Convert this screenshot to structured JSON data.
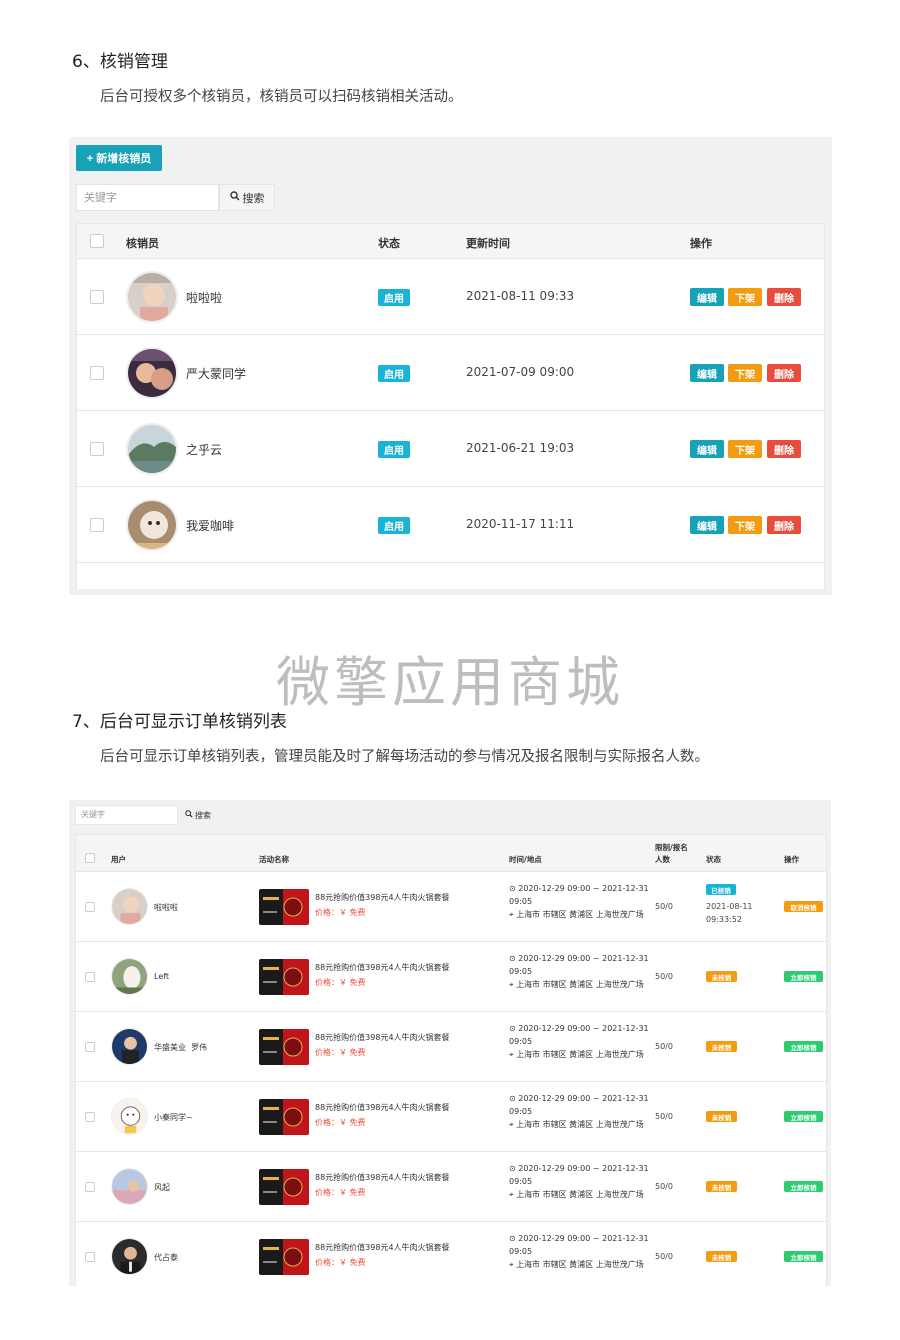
{
  "section1": {
    "title": "6、核销管理",
    "desc": "后台可授权多个核销员，核销员可以扫码核销相关活动。",
    "add_button": "+ 新增核销员",
    "search_placeholder": "关键字",
    "search_button": "搜索",
    "headers": {
      "user": "核销员",
      "status": "状态",
      "updated": "更新时间",
      "ops": "操作"
    },
    "rows": [
      {
        "name": "啦啦啦",
        "status": "启用",
        "time": "2021-08-11 09:33",
        "edit": "编辑",
        "off": "下架",
        "del": "删除"
      },
      {
        "name": "严大蒙同学",
        "status": "启用",
        "time": "2021-07-09 09:00",
        "edit": "编辑",
        "off": "下架",
        "del": "删除"
      },
      {
        "name": "之乎云",
        "status": "启用",
        "time": "2021-06-21 19:03",
        "edit": "编辑",
        "off": "下架",
        "del": "删除"
      },
      {
        "name": "我爱咖啡",
        "status": "启用",
        "time": "2020-11-17 11:11",
        "edit": "编辑",
        "off": "下架",
        "del": "删除"
      }
    ]
  },
  "watermark": "微擎应用商城",
  "section2": {
    "title": "7、后台可显示订单核销列表",
    "desc": "后台可显示订单核销列表，管理员能及时了解每场活动的参与情况及报名限制与实际报名人数。",
    "search_placeholder": "关键字",
    "search_button": "搜索",
    "headers": {
      "user": "用户",
      "activity": "活动名称",
      "time_place": "时间/地点",
      "limit_l1": "限制/报名",
      "limit_l2": "人数",
      "status": "状态",
      "ops": "操作"
    },
    "rows": [
      {
        "name": "啦啦啦",
        "activity": "88元抢购价值398元4人牛肉火锅套餐",
        "price": "价格：￥ 免费",
        "time": "2020-12-29 09:00 ~ 2021-12-31 09:05",
        "place": "上海市 市辖区 黄浦区 上海世茂广场",
        "limit": "50/0",
        "status": "已核销",
        "verified_time": "2021-08-11 09:33:52",
        "op": "取消核销"
      },
      {
        "name": "Left",
        "activity": "88元抢购价值398元4人牛肉火锅套餐",
        "price": "价格：￥ 免费",
        "time": "2020-12-29 09:00 ~ 2021-12-31 09:05",
        "place": "上海市 市辖区 黄浦区 上海世茂广场",
        "limit": "50/0",
        "status": "未核销",
        "op": "立即核销"
      },
      {
        "name": "华盛美业  罗伟",
        "activity": "88元抢购价值398元4人牛肉火锅套餐",
        "price": "价格：￥ 免费",
        "time": "2020-12-29 09:00 ~ 2021-12-31 09:05",
        "place": "上海市 市辖区 黄浦区 上海世茂广场",
        "limit": "50/0",
        "status": "未核销",
        "op": "立即核销"
      },
      {
        "name": "小秦同学~",
        "activity": "88元抢购价值398元4人牛肉火锅套餐",
        "price": "价格：￥ 免费",
        "time": "2020-12-29 09:00 ~ 2021-12-31 09:05",
        "place": "上海市 市辖区 黄浦区 上海世茂广场",
        "limit": "50/0",
        "status": "未核销",
        "op": "立即核销"
      },
      {
        "name": "风起",
        "activity": "88元抢购价值398元4人牛肉火锅套餐",
        "price": "价格：￥ 免费",
        "time": "2020-12-29 09:00 ~ 2021-12-31 09:05",
        "place": "上海市 市辖区 黄浦区 上海世茂广场",
        "limit": "50/0",
        "status": "未核销",
        "op": "立即核销"
      },
      {
        "name": "代占泰",
        "activity": "88元抢购价值398元4人牛肉火锅套餐",
        "price": "价格：￥ 免费",
        "time": "2020-12-29 09:00 ~ 2021-12-31 09:05",
        "place": "上海市 市辖区 黄浦区 上海世茂广场",
        "limit": "50/0",
        "status": "未核销",
        "op": "立即核销"
      }
    ]
  },
  "colors": {
    "primary": "#17a2b8",
    "warning": "#f39c12",
    "danger": "#e74c3c",
    "success": "#2ecc71",
    "info": "#1ab3d8"
  }
}
